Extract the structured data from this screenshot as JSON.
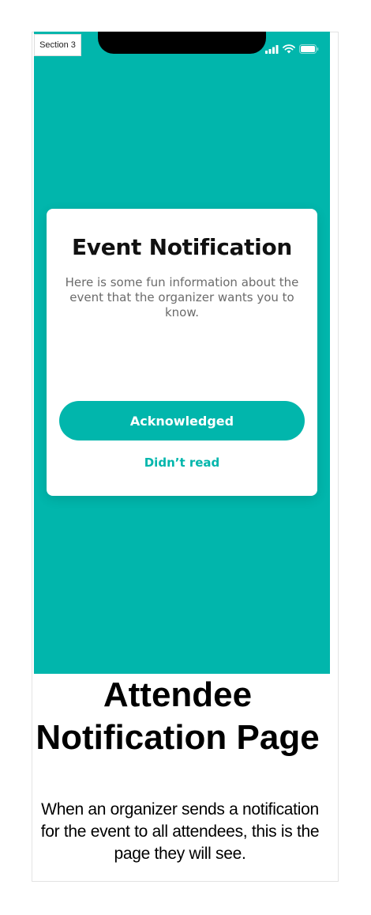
{
  "section_label": "Section 3",
  "colors": {
    "accent": "#01b6ac",
    "card_bg": "#ffffff",
    "title_text": "#111111",
    "body_text": "#6b6b6b"
  },
  "status_bar": {
    "icons": [
      "cellular-signal-icon",
      "wifi-icon",
      "battery-icon"
    ]
  },
  "modal": {
    "title": "Event Notification",
    "body": "Here is some fun information about the event that the organizer wants you to know.",
    "primary_button": "Acknowledged",
    "secondary_link": "Didn’t read"
  },
  "caption": {
    "title": "Attendee Notification Page",
    "description": "When an organizer sends a notification for the event to all attendees, this is the page they will see."
  }
}
